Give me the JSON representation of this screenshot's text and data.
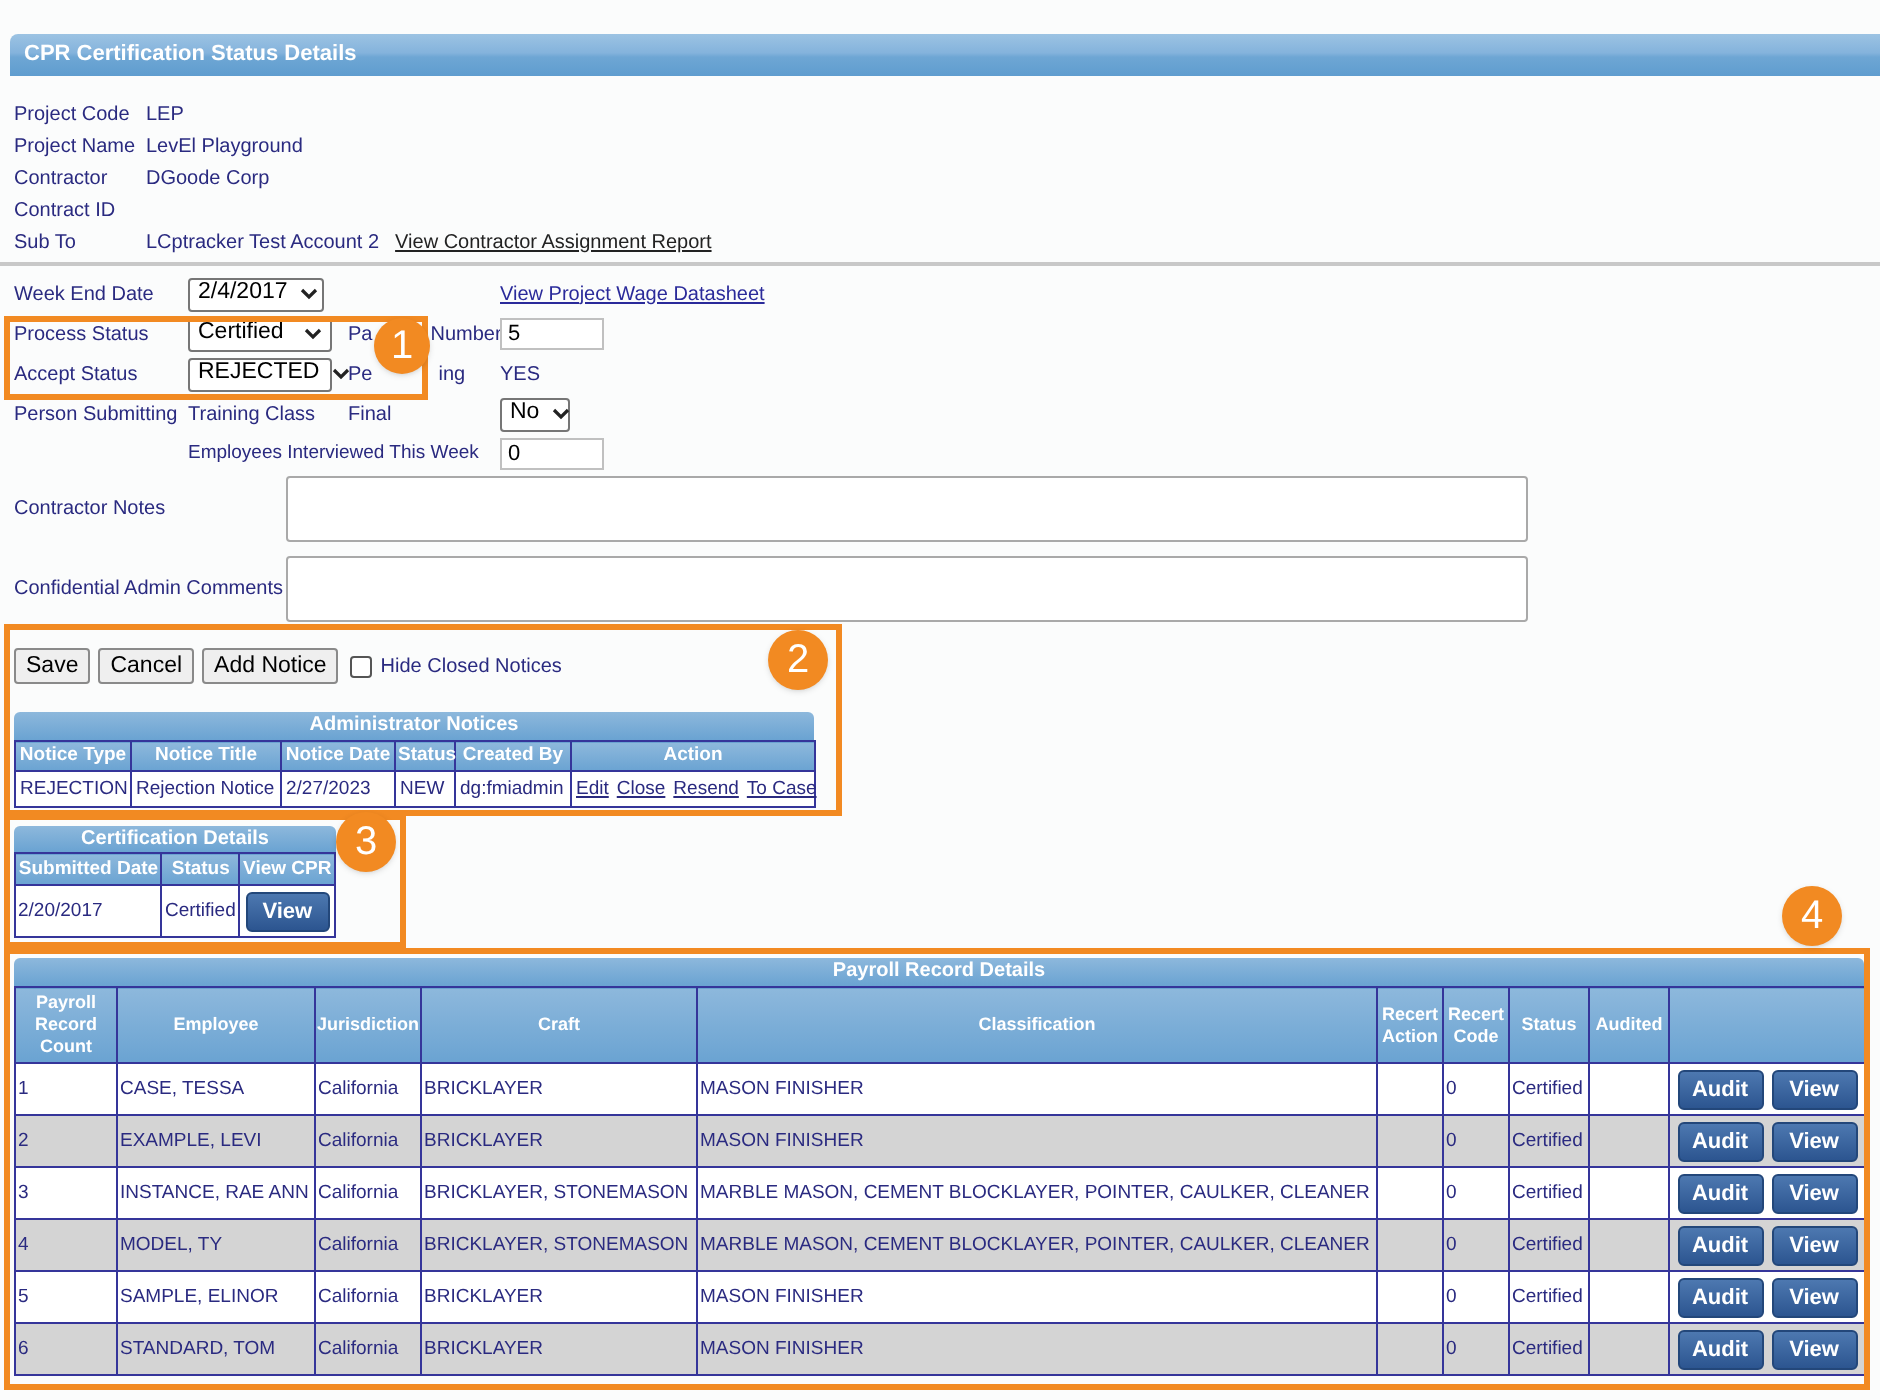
{
  "title": "CPR Certification Status Details",
  "project_info": [
    {
      "label": "Project Code",
      "value": "LEP"
    },
    {
      "label": "Project Name",
      "value": "LevEl Playground"
    },
    {
      "label": "Contractor",
      "value": "DGoode Corp"
    },
    {
      "label": "Contract ID"
    },
    {
      "label": "Sub To",
      "value": "LCptracker Test Account 2",
      "link": "View Contractor Assignment Report"
    }
  ],
  "form": {
    "week_end_date": {
      "label": "Week End Date",
      "value": "2/4/2017"
    },
    "wage_link": "View Project Wage Datasheet",
    "process_status": {
      "label": "Process Status",
      "value": "Certified"
    },
    "payroll_number": {
      "label_parts": [
        "Pa",
        "Number"
      ],
      "value": "5"
    },
    "accept_status": {
      "label": "Accept Status",
      "value": "REJECTED"
    },
    "performing": {
      "label_parts": [
        "Pe",
        "ing"
      ],
      "value": "YES"
    },
    "person_submitting": {
      "label": "Person Submitting"
    },
    "training_class": {
      "label": "Training Class"
    },
    "final": {
      "label": "Final",
      "value": "No"
    },
    "employees_interviewed": {
      "label": "Employees Interviewed This Week",
      "value": "0"
    }
  },
  "notes": [
    {
      "label": "Contractor Notes"
    },
    {
      "label": "Confidential Admin Comments"
    }
  ],
  "actions": {
    "buttons": [
      "Save",
      "Cancel",
      "Add Notice"
    ],
    "hide_closed": {
      "label": "Hide Closed Notices",
      "checked": false
    }
  },
  "admin_notices": {
    "title": "Administrator Notices",
    "columns": [
      "Notice Type",
      "Notice Title",
      "Notice Date",
      "Status",
      "Created By",
      "Action"
    ],
    "rows": [
      {
        "cells": [
          "REJECTION",
          "Rejection Notice",
          "2/27/2023",
          "NEW",
          "dg:fmiadmin"
        ],
        "actions": [
          "Edit",
          "Close",
          "Resend",
          "To Case"
        ]
      }
    ]
  },
  "certification_details": {
    "title": "Certification Details",
    "columns": [
      "Submitted Date",
      "Status",
      "View CPR"
    ],
    "rows": [
      {
        "submitted_date": "2/20/2017",
        "status": "Certified",
        "button": "View"
      }
    ]
  },
  "payroll": {
    "title": "Payroll Record Details",
    "columns": [
      "Payroll Record Count",
      "Employee",
      "Jurisdiction",
      "Craft",
      "Classification",
      "Recert Action",
      "Recert Code",
      "Status",
      "Audited"
    ],
    "rows": [
      {
        "cells": [
          "1",
          "CASE, TESSA",
          "California",
          "BRICKLAYER",
          "MASON FINISHER",
          "",
          "0",
          "Certified",
          ""
        ],
        "buttons": [
          "Audit",
          "View"
        ]
      },
      {
        "cells": [
          "2",
          "EXAMPLE, LEVI",
          "California",
          "BRICKLAYER",
          "MASON FINISHER",
          "",
          "0",
          "Certified",
          ""
        ],
        "buttons": [
          "Audit",
          "View"
        ]
      },
      {
        "cells": [
          "3",
          "INSTANCE, RAE ANN",
          "California",
          "BRICKLAYER, STONEMASON",
          "MARBLE MASON, CEMENT BLOCKLAYER, POINTER, CAULKER, CLEANER",
          "",
          "0",
          "Certified",
          ""
        ],
        "buttons": [
          "Audit",
          "View"
        ]
      },
      {
        "cells": [
          "4",
          "MODEL, TY",
          "California",
          "BRICKLAYER, STONEMASON",
          "MARBLE MASON, CEMENT BLOCKLAYER, POINTER, CAULKER, CLEANER",
          "",
          "0",
          "Certified",
          ""
        ],
        "buttons": [
          "Audit",
          "View"
        ]
      },
      {
        "cells": [
          "5",
          "SAMPLE, ELINOR",
          "California",
          "BRICKLAYER",
          "MASON FINISHER",
          "",
          "0",
          "Certified",
          ""
        ],
        "buttons": [
          "Audit",
          "View"
        ]
      },
      {
        "cells": [
          "6",
          "STANDARD, TOM",
          "California",
          "BRICKLAYER",
          "MASON FINISHER",
          "",
          "0",
          "Certified",
          ""
        ],
        "buttons": [
          "Audit",
          "View"
        ]
      }
    ]
  },
  "callouts": [
    {
      "number": "1"
    },
    {
      "number": "2"
    },
    {
      "number": "3"
    },
    {
      "number": "4"
    }
  ]
}
